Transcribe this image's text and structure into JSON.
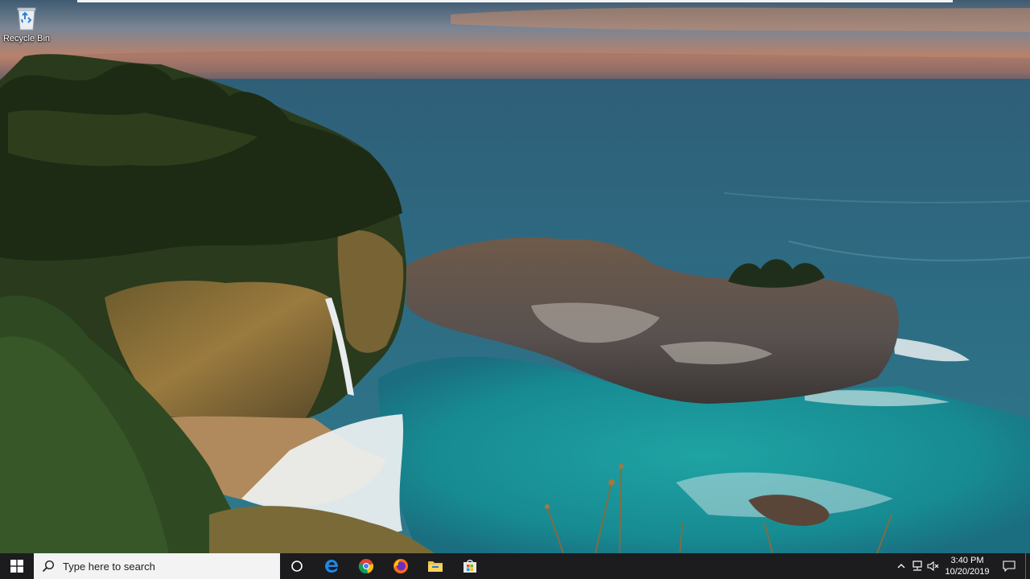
{
  "desktop": {
    "icons": [
      {
        "label": "Recycle Bin",
        "icon": "recycle-bin-icon"
      }
    ]
  },
  "taskbar": {
    "start_icon": "windows-logo-icon",
    "search": {
      "placeholder": "Type here to search",
      "icon": "search-icon"
    },
    "cortana_icon": "cortana-circle-icon",
    "pinned_apps": [
      "edge-icon",
      "chrome-icon",
      "firefox-icon",
      "file-explorer-icon",
      "store-icon"
    ],
    "tray_icons": [
      "chevron-up-icon",
      "network-icon",
      "volume-muted-icon"
    ],
    "clock": {
      "time": "3:40 PM",
      "date": "10/20/2019"
    },
    "notification_icon": "action-center-icon"
  },
  "colors": {
    "taskbar_bg": "#1c1c1e",
    "search_bg": "#f3f3f3"
  }
}
